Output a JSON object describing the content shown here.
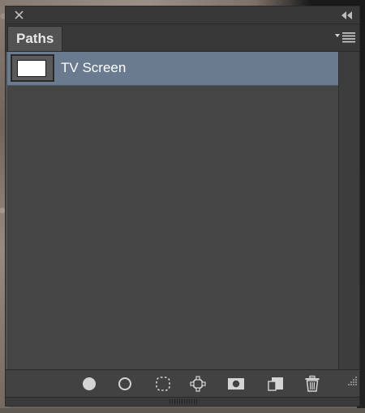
{
  "panel": {
    "tab_label": "Paths"
  },
  "paths": [
    {
      "name": "TV Screen",
      "selected": true
    }
  ],
  "toolbar": {
    "buttons": [
      {
        "icon": "fill-path-icon"
      },
      {
        "icon": "stroke-path-icon"
      },
      {
        "icon": "load-as-selection-icon"
      },
      {
        "icon": "make-work-path-icon"
      },
      {
        "icon": "add-mask-icon"
      },
      {
        "icon": "new-path-icon"
      },
      {
        "icon": "delete-path-icon"
      }
    ]
  },
  "colors": {
    "selected_row": "#6a7a8f",
    "panel_bg": "#535353",
    "list_bg": "#454545"
  }
}
